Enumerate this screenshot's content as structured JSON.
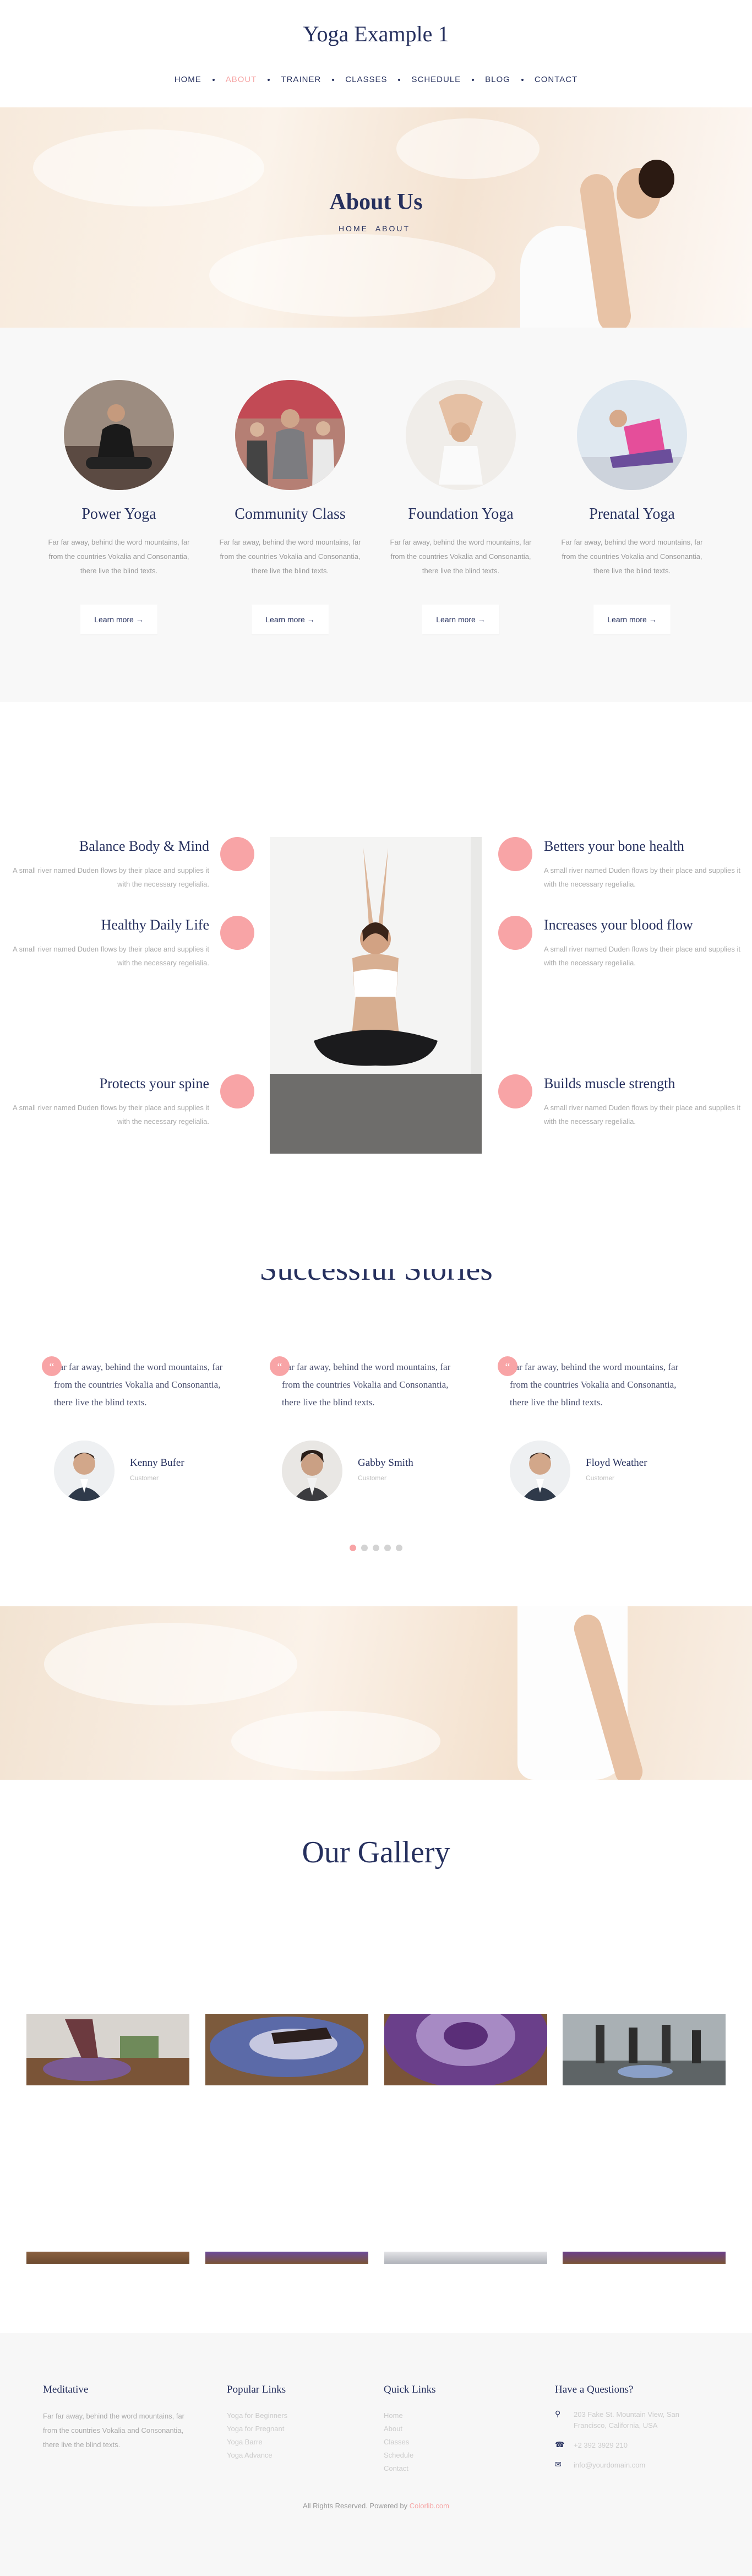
{
  "site": {
    "brand": "Yoga Example 1"
  },
  "nav": {
    "items": [
      "HOME",
      "ABOUT",
      "TRAINER",
      "CLASSES",
      "SCHEDULE",
      "BLOG",
      "CONTACT"
    ],
    "active_index": 1
  },
  "hero": {
    "title": "About Us",
    "breadcrumb": [
      "HOME",
      "ABOUT"
    ]
  },
  "classes": {
    "items": [
      {
        "name": "Power Yoga",
        "desc": "Far far away, behind the word mountains, far from the countries Vokalia and Consonantia, there live the blind texts.",
        "button": "Learn more"
      },
      {
        "name": "Community Class",
        "desc": "Far far away, behind the word mountains, far from the countries Vokalia and Consonantia, there live the blind texts.",
        "button": "Learn more"
      },
      {
        "name": "Foundation Yoga",
        "desc": "Far far away, behind the word mountains, far from the countries Vokalia and Consonantia, there live the blind texts.",
        "button": "Learn more"
      },
      {
        "name": "Prenatal Yoga",
        "desc": "Far far away, behind the word mountains, far from the countries Vokalia and Consonantia, there live the blind texts.",
        "button": "Learn more"
      }
    ]
  },
  "benefits": {
    "left": [
      {
        "title": "Balance Body & Mind",
        "desc": "A small river named Duden flows by their place and supplies it with the necessary regelialia."
      },
      {
        "title": "Healthy Daily Life",
        "desc": "A small river named Duden flows by their place and supplies it with the necessary regelialia."
      },
      {
        "title": "Protects your spine",
        "desc": "A small river named Duden flows by their place and supplies it with the necessary regelialia."
      }
    ],
    "right": [
      {
        "title": "Betters your bone health",
        "desc": "A small river named Duden flows by their place and supplies it with the necessary regelialia."
      },
      {
        "title": "Increases your blood flow",
        "desc": "A small river named Duden flows by their place and supplies it with the necessary regelialia."
      },
      {
        "title": "Builds muscle strength",
        "desc": "A small river named Duden flows by their place and supplies it with the necessary regelialia."
      }
    ]
  },
  "stories": {
    "title": "Successful Stories",
    "items": [
      {
        "quote": "Far far away, behind the word mountains, far from the countries Vokalia and Consonantia, there live the blind texts.",
        "name": "Kenny Bufer",
        "role": "Customer"
      },
      {
        "quote": "Far far away, behind the word mountains, far from the countries Vokalia and Consonantia, there live the blind texts.",
        "name": "Gabby Smith",
        "role": "Customer"
      },
      {
        "quote": "Far far away, behind the word mountains, far from the countries Vokalia and Consonantia, there live the blind texts.",
        "name": "Floyd Weather",
        "role": "Customer"
      }
    ],
    "dots": 5,
    "active_dot": 0
  },
  "gallery": {
    "title": "Our Gallery"
  },
  "footer": {
    "meditative": {
      "heading": "Meditative",
      "text": "Far far away, behind the word mountains, far from the countries Vokalia and Consonantia, there live the blind texts."
    },
    "popular": {
      "heading": "Popular Links",
      "items": [
        "Yoga for Beginners",
        "Yoga for Pregnant",
        "Yoga Barre",
        "Yoga Advance"
      ]
    },
    "quick": {
      "heading": "Quick Links",
      "items": [
        "Home",
        "About",
        "Classes",
        "Schedule",
        "Contact"
      ]
    },
    "contact": {
      "heading": "Have a Questions?",
      "address": "203 Fake St. Mountain View, San Francisco, California, USA",
      "phone": "+2 392 3929 210",
      "email": "info@yourdomain.com"
    },
    "copyright": "All Rights Reserved. Powered by",
    "powered_by": "Colorlib.com"
  },
  "colors": {
    "navy": "#26305e",
    "accent": "#f8a4a6"
  },
  "icons": {
    "map": "map-marker-icon",
    "phone": "phone-icon",
    "email": "envelope-icon"
  }
}
